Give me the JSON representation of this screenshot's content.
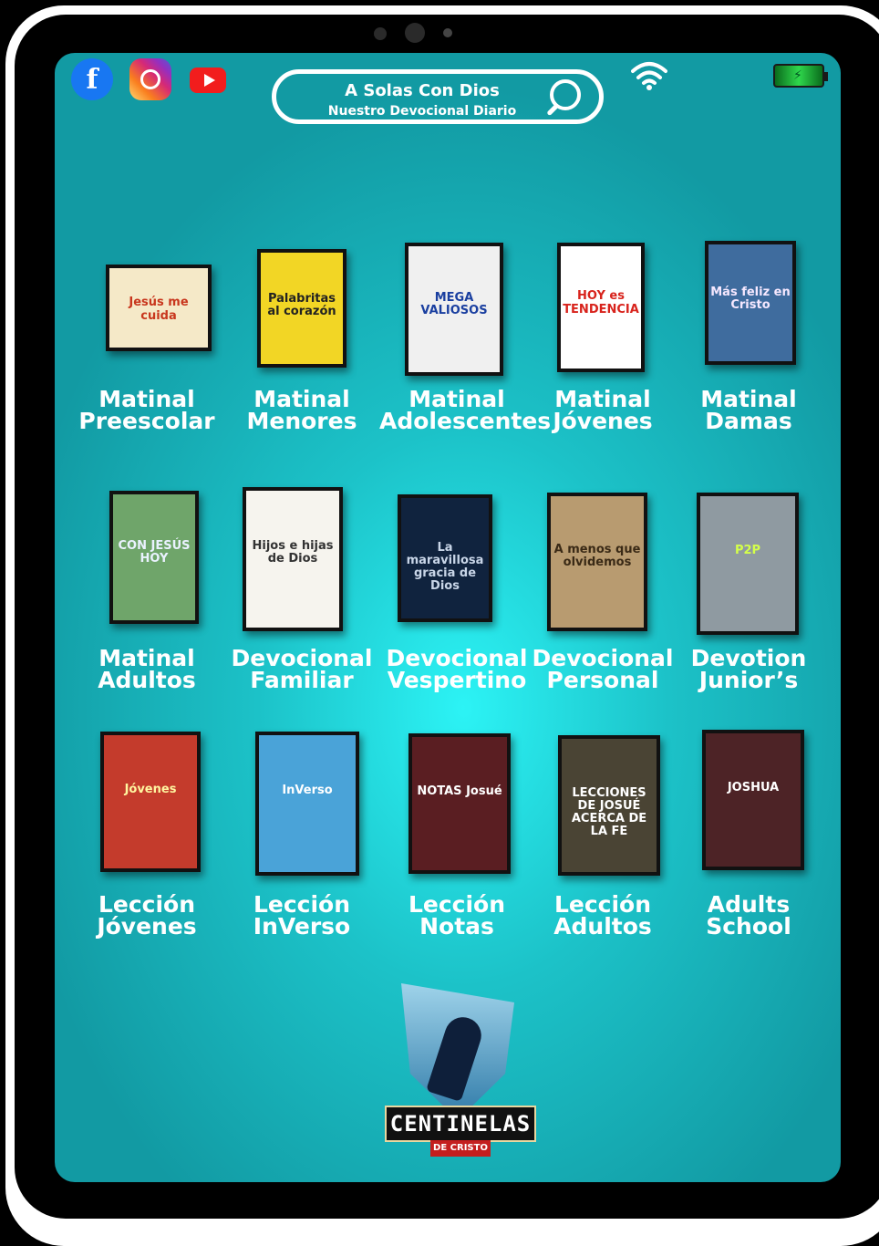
{
  "header": {
    "search_title": "A Solas Con Dios",
    "search_subtitle": "Nuestro Devocional Diario",
    "social_icons": [
      "facebook-icon",
      "instagram-icon",
      "youtube-icon"
    ],
    "status_icons": [
      "wifi-icon",
      "battery-icon"
    ]
  },
  "colors": {
    "screen_center": "#2cf3f5",
    "screen_edge": "#129aa3",
    "facebook": "#1877f2",
    "youtube": "#f21d1d"
  },
  "books": [
    {
      "label": "Matinal Preescolar",
      "cover_text": "Jesús me cuida"
    },
    {
      "label": "Matinal Menores",
      "cover_text": "Palabritas al corazón"
    },
    {
      "label": "Matinal Adolescentes",
      "cover_text": "MEGA VALIOSOS"
    },
    {
      "label": "Matinal Jóvenes",
      "cover_text": "HOY es TENDENCIA"
    },
    {
      "label": "Matinal Damas",
      "cover_text": "Más feliz en Cristo"
    },
    {
      "label": "Matinal Adultos",
      "cover_text": "CON JESÚS HOY"
    },
    {
      "label": "Devocional Familiar",
      "cover_text": "Hijos e hijas de Dios"
    },
    {
      "label": "Devocional Vespertino",
      "cover_text": "La maravillosa gracia de Dios"
    },
    {
      "label": "Devocional Personal",
      "cover_text": "A menos que olvidemos"
    },
    {
      "label": "Devotion Junior’s",
      "cover_text": "P2P"
    },
    {
      "label": "Lección Jóvenes",
      "cover_text": "Jóvenes"
    },
    {
      "label": "Lección InVerso",
      "cover_text": "InVerso"
    },
    {
      "label": "Lección Notas",
      "cover_text": "NOTAS Josué"
    },
    {
      "label": "Lección Adultos",
      "cover_text": "LECCIONES DE JOSUÉ ACERCA DE LA FE"
    },
    {
      "label": "Adults School",
      "cover_text": "JOSHUA"
    }
  ],
  "logo": {
    "name": "CENTINELAS",
    "sub": "DE CRISTO"
  }
}
